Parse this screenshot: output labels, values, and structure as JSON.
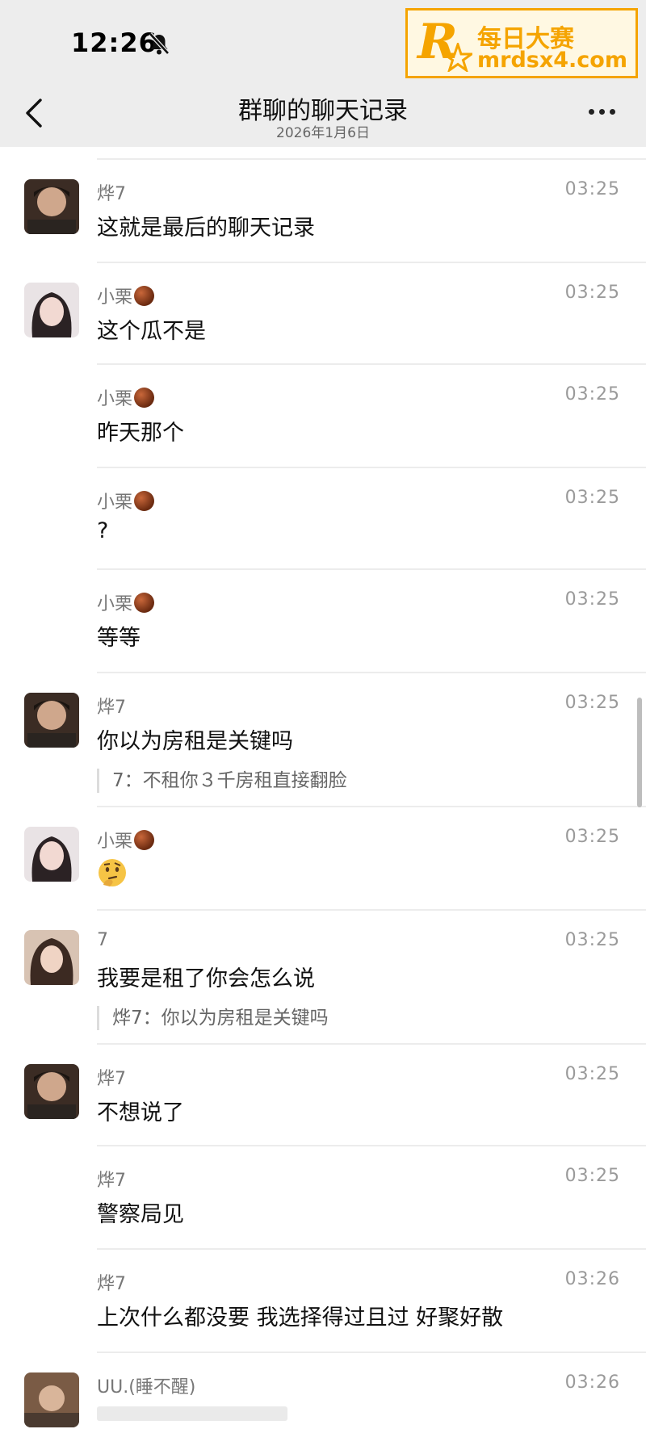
{
  "status_bar": {
    "time": "12:26",
    "icons": [
      "bell-slash-icon"
    ]
  },
  "watermark": {
    "letter": "R",
    "name": "每日大赛",
    "url": "mrdsx4.com",
    "color": "#f5a400"
  },
  "nav": {
    "title": "群聊的聊天记录",
    "subtitle": "2026年1月6日",
    "icons": [
      "chevron-left-icon",
      "more-icon"
    ]
  },
  "messages": [
    {
      "sender": "烨7",
      "badge": false,
      "time": "03:25",
      "text": "这就是最后的聊天记录",
      "quote": "",
      "avatar": "avatar-ye7"
    },
    {
      "sender": "小栗",
      "badge": true,
      "time": "03:25",
      "text": "这个瓜不是",
      "quote": "",
      "avatar": "avatar-xiaoli"
    },
    {
      "sender": "小栗",
      "badge": true,
      "time": "03:25",
      "text": "昨天那个",
      "quote": "",
      "avatar": ""
    },
    {
      "sender": "小栗",
      "badge": true,
      "time": "03:25",
      "text": "?",
      "quote": "",
      "avatar": ""
    },
    {
      "sender": "小栗",
      "badge": true,
      "time": "03:25",
      "text": "等等",
      "quote": "",
      "avatar": ""
    },
    {
      "sender": "烨7",
      "badge": false,
      "time": "03:25",
      "text": "你以为房租是关键吗",
      "quote": "7：不租你３千房租直接翻脸",
      "avatar": "avatar-ye7"
    },
    {
      "sender": "小栗",
      "badge": true,
      "time": "03:25",
      "text": "",
      "emoji": "thinking-face-icon",
      "quote": "",
      "avatar": "avatar-xiaoli"
    },
    {
      "sender": "7",
      "badge": false,
      "time": "03:25",
      "text": "我要是租了你会怎么说",
      "quote": "烨7：你以为房租是关键吗",
      "avatar": "avatar-7"
    },
    {
      "sender": "烨7",
      "badge": false,
      "time": "03:25",
      "text": "不想说了",
      "quote": "",
      "avatar": "avatar-ye7"
    },
    {
      "sender": "烨7",
      "badge": false,
      "time": "03:25",
      "text": "警察局见",
      "quote": "",
      "avatar": ""
    },
    {
      "sender": "烨7",
      "badge": false,
      "time": "03:26",
      "text": "上次什么都没要 我选择得过且过 好聚好散",
      "quote": "",
      "avatar": ""
    },
    {
      "sender": "UU.(睡不醒)",
      "badge": false,
      "time": "03:26",
      "text": "",
      "quote": "",
      "avatar": "avatar-uu"
    }
  ],
  "colors": {
    "header_bg": "#ededed",
    "divider": "#ececec",
    "time_text": "#9a9a9a"
  }
}
